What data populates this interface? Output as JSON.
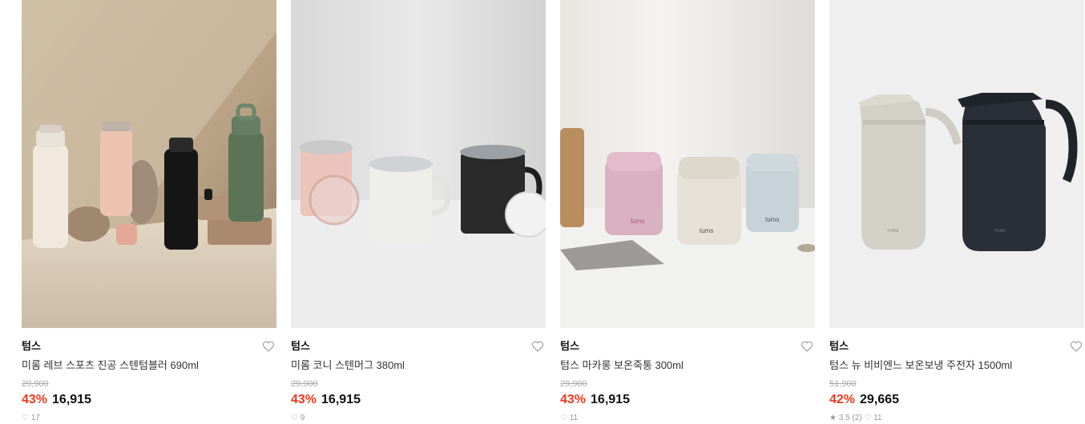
{
  "products": [
    {
      "brand": "텀스",
      "name": "미롬 레브 스포츠 진공 스텐텀블러 690ml",
      "original_price": "29,900",
      "discount_rate": "43%",
      "price": "16,915",
      "meta": "♡ 17"
    },
    {
      "brand": "텀스",
      "name": "미롬 코니 스텐머그 380ml",
      "original_price": "29,900",
      "discount_rate": "43%",
      "price": "16,915",
      "meta": "♡ 9"
    },
    {
      "brand": "텀스",
      "name": "텀스 마카롱 보온죽통 300ml",
      "original_price": "29,900",
      "discount_rate": "43%",
      "price": "16,915",
      "meta": "♡ 11"
    },
    {
      "brand": "텀스",
      "name": "텀스 뉴 비비엔느 보온보냉 주전자 1500ml",
      "original_price": "51,900",
      "discount_rate": "42%",
      "price": "29,665",
      "meta": "★ 3.5 (2)  ♡ 11"
    }
  ],
  "product_images": [
    "sports-tumblers-photo",
    "stainless-mugs-photo",
    "food-jars-photo",
    "vacuum-jugs-photo"
  ],
  "tums_logo_text": "tums",
  "jug_logo_text": "TUMS",
  "colors": {
    "discount": "#ef3a1f",
    "strike": "#aaaaaa"
  }
}
